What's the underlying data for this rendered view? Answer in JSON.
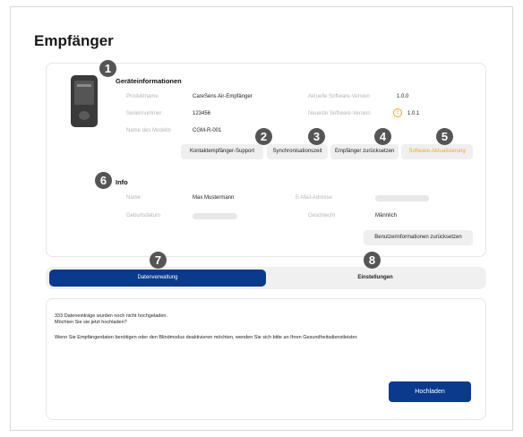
{
  "page": {
    "title": "Empfänger"
  },
  "device_info": {
    "title": "Geräteinformationen",
    "product_name": {
      "label": "Produktname",
      "value": "CareSens Air-Empfänger"
    },
    "serial": {
      "label": "Seriennummer",
      "value": "123456"
    },
    "model": {
      "label": "Name des Modells",
      "value": "CGM-R-001"
    },
    "current_sw": {
      "label": "Aktuelle Software-Version",
      "value": "1.0.0"
    },
    "latest_sw": {
      "label": "Neueste Software-Version",
      "value": "1.0.1"
    },
    "actions": {
      "support": "Kontaktempfänger-Support",
      "sync": "Synchronisationszeit",
      "reset": "Empfänger zurücksetzen",
      "update": "Software-Aktualisierung"
    }
  },
  "info": {
    "title": "Info",
    "name": {
      "label": "Name",
      "value": "Max Mustermann"
    },
    "birthdate": {
      "label": "Geburtsdatum"
    },
    "email": {
      "label": "E-Mail-Adresse"
    },
    "gender": {
      "label": "Geschlecht",
      "value": "Männlich"
    },
    "reset_user": "Benutzerinformationen zurücksetzen"
  },
  "tabs": {
    "data": "Datenverwaltung",
    "settings": "Einstellungen"
  },
  "data_panel": {
    "line1": "333 Dateneinträge wurden noch nicht hochgeladen.",
    "line2": "Möchten Sie sie jetzt hochladen?",
    "line3": "Wenn Sie Empfängerdaten benötigen oder den Blindmodus deaktivieren möchten, wenden Sie sich bitte an Ihren Gesundheitsdienstleister.",
    "upload": "Hochladen"
  },
  "markers": [
    "1",
    "2",
    "3",
    "4",
    "5",
    "6",
    "7",
    "8"
  ],
  "colors": {
    "accent": "#0b3a8c",
    "warning": "#f5a623",
    "marker": "#555555"
  },
  "icons": {
    "warning": "warning-icon",
    "device": "receiver-device-icon"
  }
}
